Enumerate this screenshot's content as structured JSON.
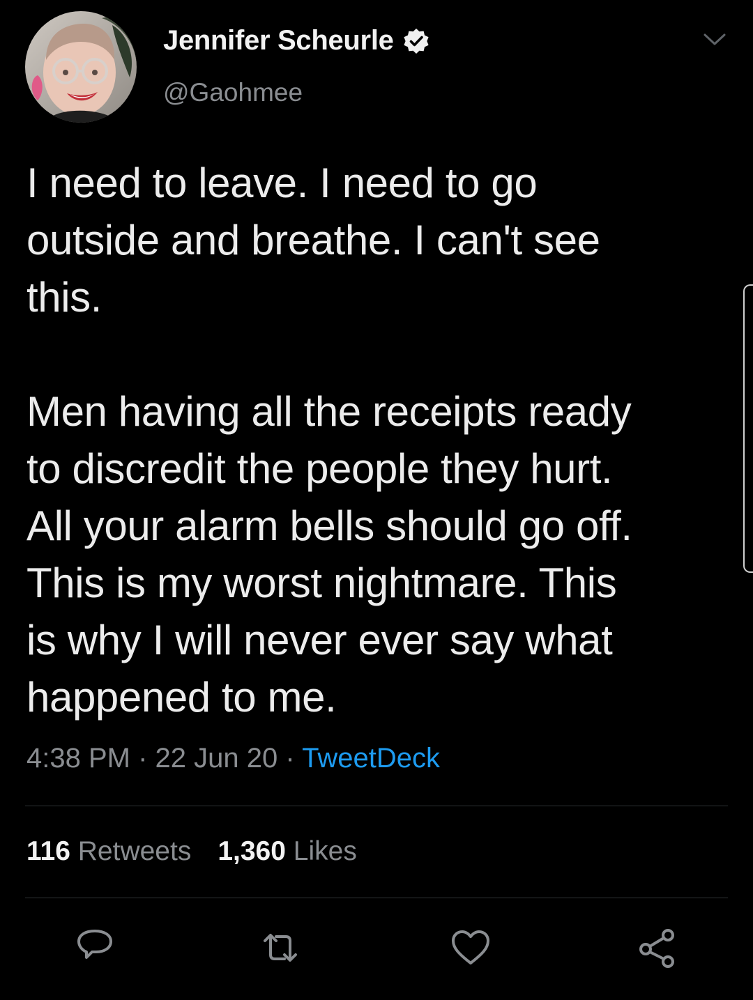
{
  "author": {
    "display_name": "Jennifer Scheurle",
    "handle": "@Gaohmee",
    "verified": true,
    "avatar_icon": "profile-photo"
  },
  "tweet": {
    "text": "I need to leave. I need to go\noutside and breathe. I can't see\nthis.\n\nMen having all the receipts ready\nto discredit the people they hurt.\nAll your alarm bells should go off.\nThis is my worst nightmare. This\nis why I will never ever say what\nhappened to me.",
    "time": "4:38 PM",
    "separator": "·",
    "date": "22 Jun 20",
    "source": "TweetDeck"
  },
  "stats": {
    "retweets_count": "116",
    "retweets_label": "Retweets",
    "likes_count": "1,360",
    "likes_label": "Likes"
  },
  "actions": [
    "reply-icon",
    "retweet-icon",
    "like-icon",
    "share-icon"
  ],
  "colors": {
    "background": "#000000",
    "text": "#ececec",
    "secondary": "#8a8d91",
    "link": "#1d9bf0",
    "divider": "#2f3336"
  }
}
